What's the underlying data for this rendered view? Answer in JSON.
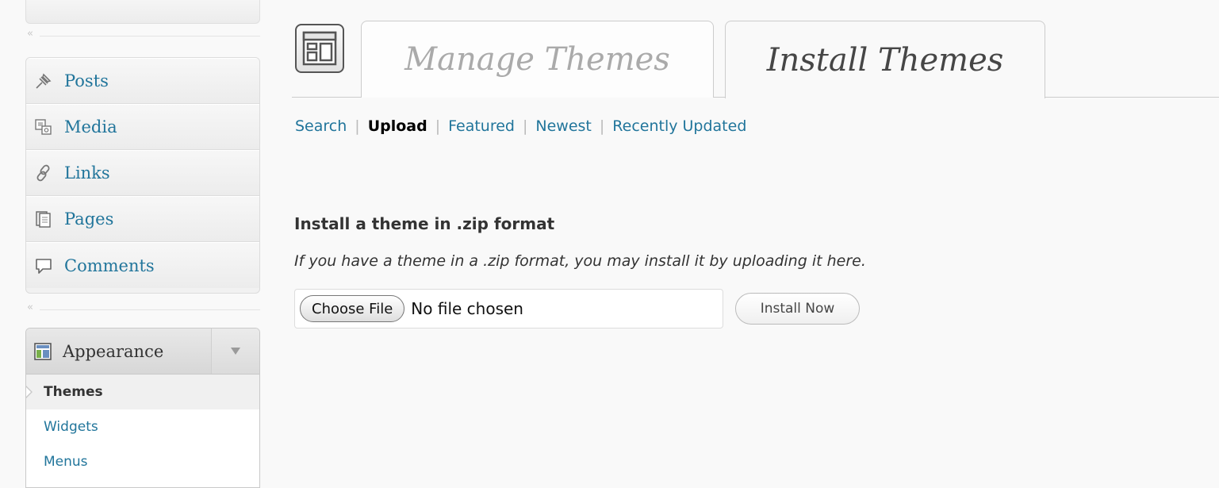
{
  "sidebar": {
    "collapse_glyph": "«",
    "items": [
      {
        "label": "Posts",
        "icon": "pushpin-icon"
      },
      {
        "label": "Media",
        "icon": "media-icon"
      },
      {
        "label": "Links",
        "icon": "chain-link-icon"
      },
      {
        "label": "Pages",
        "icon": "pages-icon"
      },
      {
        "label": "Comments",
        "icon": "speech-bubble-icon"
      }
    ],
    "appearance": {
      "label": "Appearance",
      "icon": "appearance-icon",
      "toggle_icon": "triangle-down-icon",
      "submenu": [
        {
          "label": "Themes",
          "current": true
        },
        {
          "label": "Widgets",
          "current": false
        },
        {
          "label": "Menus",
          "current": false
        }
      ]
    }
  },
  "tabs": {
    "manage": "Manage Themes",
    "install": "Install Themes",
    "active": "install"
  },
  "subnav": {
    "search": "Search",
    "upload": "Upload",
    "featured": "Featured",
    "newest": "Newest",
    "recently_updated": "Recently Updated",
    "separator": "|",
    "current": "upload"
  },
  "upload": {
    "heading": "Install a theme in .zip format",
    "description": "If you have a theme in a .zip format, you may install it by uploading it here.",
    "choose_file_label": "Choose File",
    "file_status": "No file chosen",
    "install_label": "Install Now"
  },
  "colors": {
    "link": "#21759b",
    "text": "#333333",
    "background": "#f9f9f9"
  }
}
